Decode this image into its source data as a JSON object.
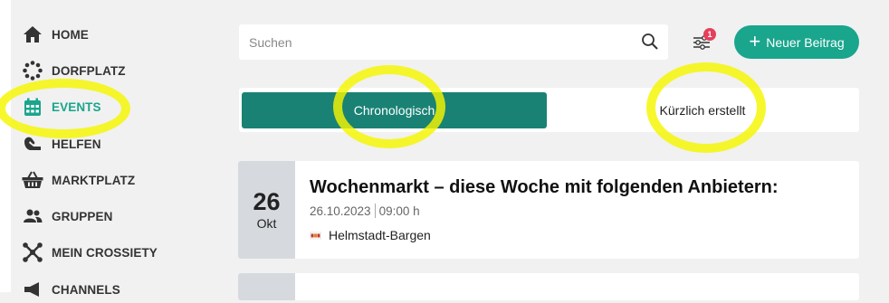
{
  "sidebar": {
    "items": [
      {
        "label": "HOME",
        "icon": "home-icon"
      },
      {
        "label": "DORFPLATZ",
        "icon": "dots-circle-icon"
      },
      {
        "label": "EVENTS",
        "icon": "calendar-icon"
      },
      {
        "label": "HELFEN",
        "icon": "helping-hand-icon"
      },
      {
        "label": "MARKTPLATZ",
        "icon": "basket-icon"
      },
      {
        "label": "GRUPPEN",
        "icon": "group-icon"
      },
      {
        "label": "MEIN CROSSIETY",
        "icon": "network-icon"
      },
      {
        "label": "CHANNELS",
        "icon": "megaphone-icon"
      }
    ],
    "active_item": "EVENTS"
  },
  "search": {
    "placeholder": "Suchen",
    "value": ""
  },
  "filter": {
    "badge_count": "1"
  },
  "new_post_button": {
    "label": "Neuer Beitrag"
  },
  "tabs": [
    {
      "label": "Chronologisch",
      "selected": true
    },
    {
      "label": "Kürzlich erstellt",
      "selected": false
    }
  ],
  "events": [
    {
      "day": "26",
      "month": "Okt",
      "title": "Wochenmarkt – diese Woche mit folgenden Anbietern:",
      "date": "26.10.2023",
      "time": "09:00 h",
      "location": "Helmstadt-Bargen"
    }
  ],
  "colors": {
    "accent": "#1aa58d",
    "selected_tab": "#1a8274",
    "badge": "#e4405a",
    "highlight": "#f5f500",
    "background": "#f1f1f1"
  }
}
